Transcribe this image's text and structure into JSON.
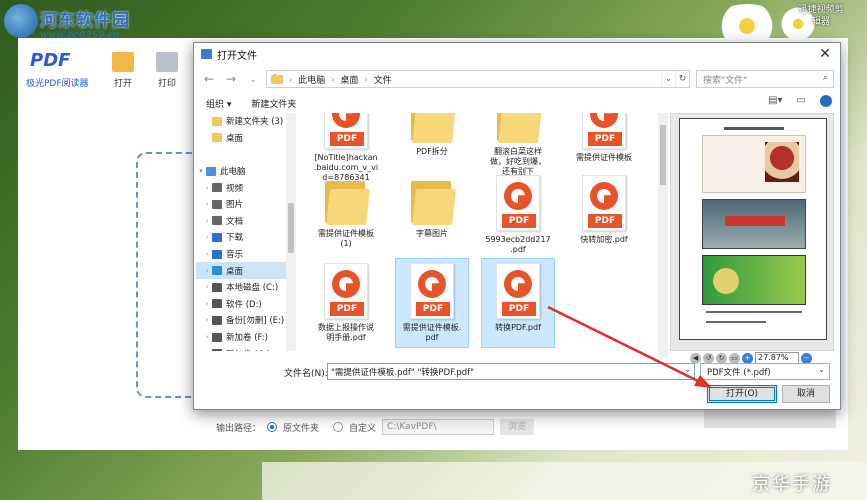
{
  "watermark": {
    "site_name": "河东软件园",
    "url": "www.pc0359.cn",
    "bottom_text": "京华手游"
  },
  "desktop": {
    "top_right_label": "迅捷视频剪辑器"
  },
  "app": {
    "logo": "PDF",
    "logo_sub": "极光PDF阅读器",
    "toolbar": [
      {
        "label": "打开",
        "icon": "open-folder-icon",
        "color": "#f1b94a"
      },
      {
        "label": "打印",
        "icon": "printer-icon",
        "color": "#b9c0c9"
      }
    ],
    "output_label": "输出路径：",
    "output_option_source": "原文件夹",
    "output_option_custom": "自定义",
    "output_path": "C:\\KavPDF\\",
    "browse_label": "浏览",
    "start_label": "开始合并"
  },
  "dialog": {
    "title": "打开文件",
    "breadcrumb": [
      "此电脑",
      "桌面",
      "文件"
    ],
    "search_placeholder": "搜索\"文件\"",
    "organize_label": "组织 ▾",
    "new_folder_label": "新建文件夹",
    "nav_items": [
      {
        "label": "新建文件夹 (3)",
        "icon": "folder-icon",
        "color": "#f1c95a",
        "indent": 1
      },
      {
        "label": "桌面",
        "icon": "folder-icon",
        "color": "#f1c95a",
        "indent": 1
      },
      {
        "label": "",
        "icon": "",
        "color": "",
        "indent": 0
      },
      {
        "label": "此电脑",
        "icon": "computer-icon",
        "color": "#4a90d9",
        "indent": 0,
        "arrow": "▾"
      },
      {
        "label": "视频",
        "icon": "video-icon",
        "color": "#666666",
        "indent": 1,
        "arrow": "›"
      },
      {
        "label": "图片",
        "icon": "picture-icon",
        "color": "#666666",
        "indent": 1,
        "arrow": "›"
      },
      {
        "label": "文档",
        "icon": "document-icon",
        "color": "#666666",
        "indent": 1,
        "arrow": "›"
      },
      {
        "label": "下载",
        "icon": "download-icon",
        "color": "#2b6fd6",
        "indent": 1,
        "arrow": "›"
      },
      {
        "label": "音乐",
        "icon": "music-icon",
        "color": "#2b6fd6",
        "indent": 1,
        "arrow": "›"
      },
      {
        "label": "桌面",
        "icon": "desktop-icon",
        "color": "#2b8fd6",
        "indent": 1,
        "arrow": "›",
        "selected": true
      },
      {
        "label": "本地磁盘 (C:)",
        "icon": "drive-icon",
        "color": "#555555",
        "indent": 1,
        "arrow": "›"
      },
      {
        "label": "软件 (D:)",
        "icon": "drive-icon",
        "color": "#555555",
        "indent": 1,
        "arrow": "›"
      },
      {
        "label": "备份[勿删] (E:)",
        "icon": "drive-icon",
        "color": "#555555",
        "indent": 1,
        "arrow": "›"
      },
      {
        "label": "新加卷 (F:)",
        "icon": "drive-icon",
        "color": "#555555",
        "indent": 1,
        "arrow": "›"
      },
      {
        "label": "新加卷 (G:)",
        "icon": "drive-icon",
        "color": "#555555",
        "indent": 1,
        "arrow": "›"
      }
    ],
    "files": [
      {
        "name": "[NoTitle]hackan\n.baidu.com_v_vi\nd=8786341",
        "type": "pdf",
        "col": 0,
        "row": 0,
        "partial": true
      },
      {
        "name": "PDF拆分",
        "type": "folder",
        "col": 1,
        "row": 0,
        "partial": true
      },
      {
        "name": "翻滚白菜这样\n做，好吃到爆，\n还有别下",
        "type": "folder",
        "col": 2,
        "row": 0,
        "partial": true
      },
      {
        "name": "需提供证件模板",
        "type": "pdf",
        "col": 3,
        "row": 0,
        "partial": true
      },
      {
        "name": "需提供证件模板\n(1)",
        "type": "folder",
        "col": 0,
        "row": 1
      },
      {
        "name": "字幕图片",
        "type": "folder",
        "col": 1,
        "row": 1
      },
      {
        "name": "5993ecb2dd217\n.pdf",
        "type": "pdf",
        "col": 2,
        "row": 1
      },
      {
        "name": "快转加密.pdf",
        "type": "pdf",
        "col": 3,
        "row": 1
      },
      {
        "name": "数据上报操作说\n明手册.pdf",
        "type": "pdf",
        "col": 0,
        "row": 2
      },
      {
        "name": "需提供证件模板.\npdf",
        "type": "pdf",
        "col": 1,
        "row": 2,
        "selected": true
      },
      {
        "name": "转换PDF.pdf",
        "type": "pdf",
        "col": 2,
        "row": 2,
        "selected": true
      }
    ],
    "pdf_badge": "PDF",
    "zoom": "27.87%",
    "filename_label": "文件名(N):",
    "filename_value": "\"需提供证件模板.pdf\" \"转换PDF.pdf\"",
    "filetype_value": "PDF文件 (*.pdf)",
    "open_label": "打开(O)",
    "cancel_label": "取消"
  }
}
